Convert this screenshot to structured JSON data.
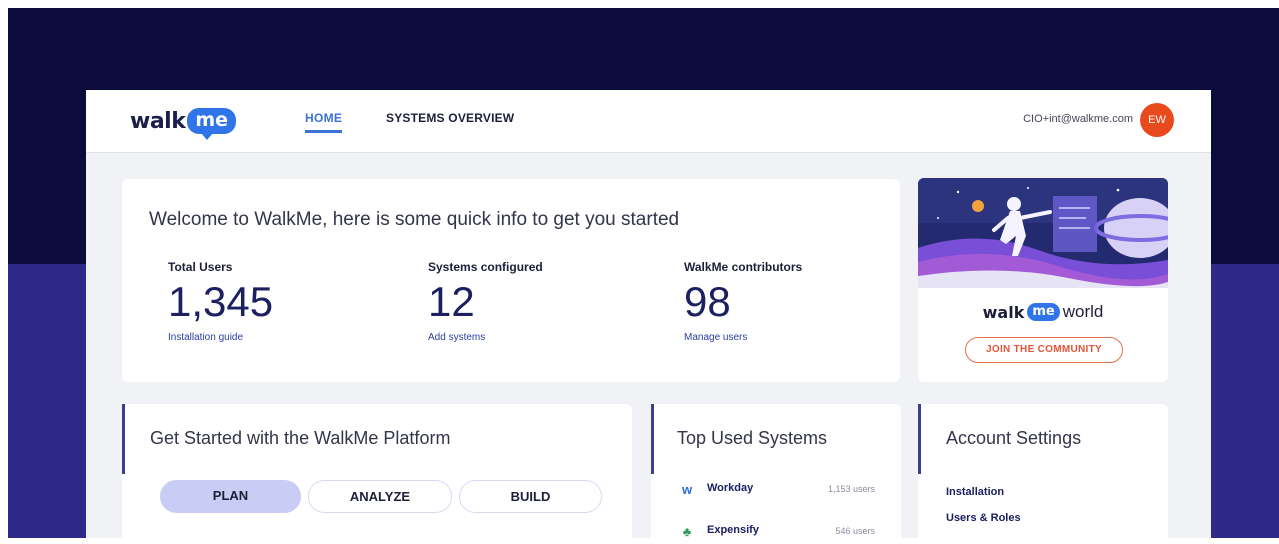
{
  "header": {
    "logo_text": "walk",
    "logo_bubble": "me",
    "nav": {
      "home": "HOME",
      "systems_overview": "SYSTEMS OVERVIEW"
    },
    "user_email": "CIO+int@walkme.com",
    "avatar_initials": "EW"
  },
  "welcome": {
    "title": "Welcome to WalkMe,  here is some quick info to get you started",
    "stats": [
      {
        "label": "Total Users",
        "value": "1,345",
        "link": "Installation guide"
      },
      {
        "label": "Systems configured",
        "value": "12",
        "link": "Add systems"
      },
      {
        "label": "WalkMe contributors",
        "value": "98",
        "link": "Manage users"
      }
    ]
  },
  "promo": {
    "logo_walk": "walk",
    "logo_me": "me",
    "logo_world": "world",
    "cta": "JOIN THE COMMUNITY"
  },
  "get_started": {
    "title": "Get Started with the WalkMe Platform",
    "tabs": [
      "PLAN",
      "ANALYZE",
      "BUILD"
    ]
  },
  "top_used": {
    "title": "Top Used Systems",
    "systems": [
      {
        "name": "Workday",
        "users": "1,153 users",
        "icon": "workday-icon"
      },
      {
        "name": "Expensify",
        "users": "546 users",
        "icon": "expensify-icon"
      }
    ]
  },
  "account": {
    "title": "Account Settings",
    "links": [
      "Installation",
      "Users & Roles"
    ]
  },
  "colors": {
    "navy_bg": "#0c0c3c",
    "indigo_bg": "#2d2a8c",
    "brand_blue": "#2f74e8",
    "avatar_orange": "#e8491d",
    "plan_pill": "#c9ccf5"
  }
}
